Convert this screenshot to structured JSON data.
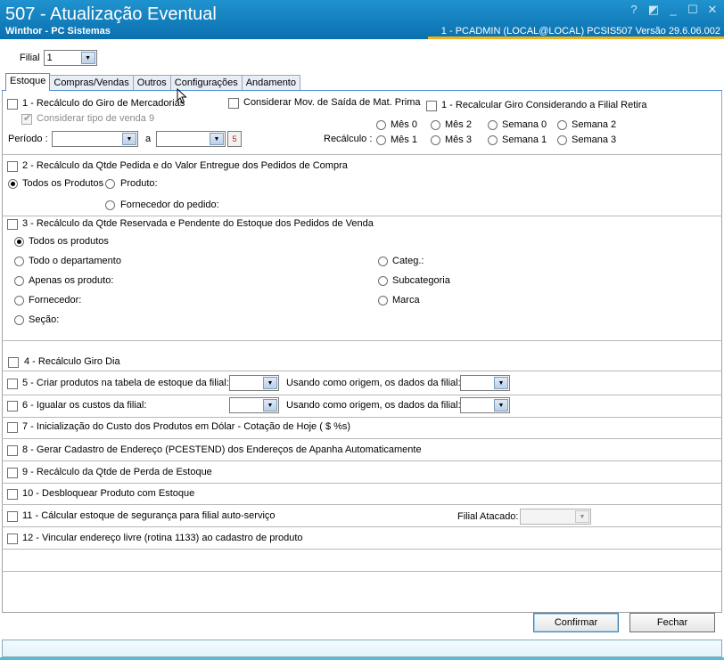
{
  "window": {
    "title": "507 - Atualização Eventual",
    "subtitle": "Winthor - PC Sistemas",
    "status": "1 - PCADMIN (LOCAL@LOCAL)   PCSIS507  Versão  29.6.06.002",
    "controls": {
      "help": "?",
      "minimize": "_",
      "maximize": "☐",
      "close": "✕"
    }
  },
  "filial": {
    "label": "Filial",
    "value": "1"
  },
  "tabs": [
    "Estoque",
    "Compras/Vendas",
    "Outros",
    "Configurações",
    "Andamento"
  ],
  "section1": {
    "recalc_giro": "1 - Recálculo do Giro de Mercadorias",
    "considerar_mov": "Considerar Mov. de Saída de Mat. Prima",
    "recalc_filial_retira": "1 - Recalcular Giro Considerando a Filial Retira",
    "considerar_tipo_venda": "Considerar tipo de venda 9",
    "periodo_label": "Período :",
    "a_label": "a",
    "calendar_text": "5",
    "recalculo_label": "Recálculo :",
    "options_row1": [
      "Mês 0",
      "Mês 2",
      "Semana 0",
      "Semana 2"
    ],
    "options_row2": [
      "Mês 1",
      "Mês 3",
      "Semana 1",
      "Semana 3"
    ]
  },
  "section2": {
    "title": "2 - Recálculo da Qtde Pedida e do Valor Entregue dos Pedidos de Compra",
    "todos": "Todos os Produtos",
    "produto": "Produto:",
    "fornecedor": "Fornecedor do pedido:"
  },
  "section3": {
    "title": "3 - Recálculo da Qtde Reservada e Pendente do Estoque dos Pedidos de Venda",
    "left_options": [
      "Todos os produtos",
      "Todo o departamento",
      "Apenas os produto:",
      "Fornecedor:",
      "Seção:"
    ],
    "right_options": [
      "Categ.:",
      "Subcategoria",
      "Marca"
    ]
  },
  "section4": {
    "title": "4 - Recálculo Giro Dia"
  },
  "section5": {
    "title": "5 - Criar produtos na tabela de estoque da filial:",
    "origem": "Usando como origem, os dados da filial:"
  },
  "section6": {
    "title": "6 - Igualar os custos da filial:",
    "origem": "Usando como origem, os dados da filial:"
  },
  "section7": {
    "title": "7 - Inicialização do Custo dos Produtos em Dólar - Cotação de Hoje ( $ %s)"
  },
  "section8": {
    "title": "8 - Gerar Cadastro de Endereço (PCESTEND) dos Endereços de Apanha Automaticamente"
  },
  "section9": {
    "title": "9 - Recálculo da Qtde de Perda de Estoque"
  },
  "section10": {
    "title": "10 - Desbloquear Produto com Estoque"
  },
  "section11": {
    "title": "11 - Cálcular estoque de segurança para filial auto-serviço",
    "filial_atacado": "Filial Atacado:"
  },
  "section12": {
    "title": "12 - Vincular endereço livre (rotina 1133) ao cadastro de produto"
  },
  "buttons": {
    "confirmar": "Confirmar",
    "fechar": "Fechar"
  }
}
